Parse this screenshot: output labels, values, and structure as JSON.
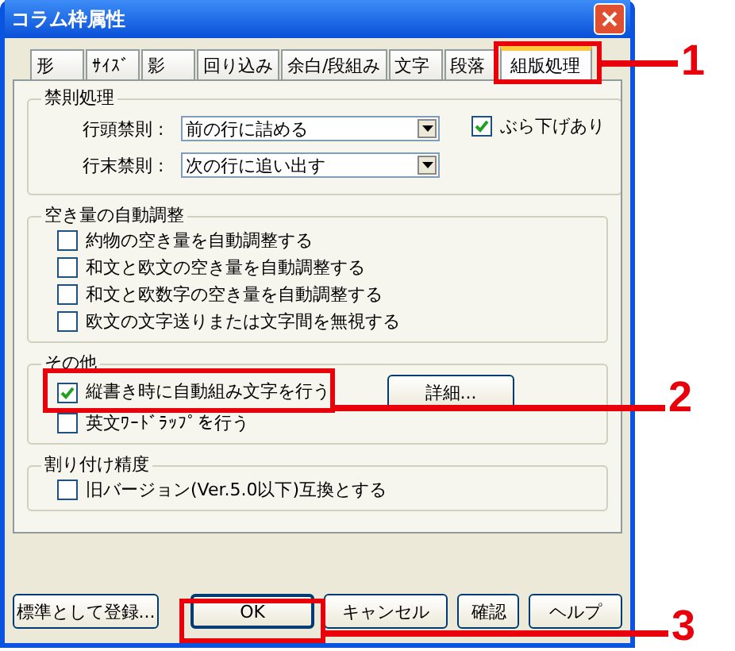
{
  "window": {
    "title": "コラム枠属性"
  },
  "tabs": [
    {
      "label": "形",
      "selected": false
    },
    {
      "label": "ｻｲｽﾞ",
      "selected": false
    },
    {
      "label": "影",
      "selected": false
    },
    {
      "label": "回り込み",
      "selected": false
    },
    {
      "label": "余白/段組み",
      "selected": false
    },
    {
      "label": "文字",
      "selected": false
    },
    {
      "label": "段落",
      "selected": false
    },
    {
      "label": "組版処理",
      "selected": true
    }
  ],
  "kinsoku": {
    "title": "禁則処理",
    "rows": [
      {
        "label": "行頭禁則 :",
        "value": "前の行に詰める"
      },
      {
        "label": "行末禁則 :",
        "value": "次の行に追い出す"
      }
    ],
    "hanging": {
      "label": "ぶら下げあり",
      "checked": true
    }
  },
  "spacing": {
    "title": "空き量の自動調整",
    "options": [
      {
        "label": "約物の空き量を自動調整する",
        "checked": false
      },
      {
        "label": "和文と欧文の空き量を自動調整する",
        "checked": false
      },
      {
        "label": "和文と欧数字の空き量を自動調整する",
        "checked": false
      },
      {
        "label": "欧文の文字送りまたは文字間を無視する",
        "checked": false
      }
    ]
  },
  "other": {
    "title": "その他",
    "options": [
      {
        "label": "縦書き時に自動組み文字を行う",
        "checked": true
      },
      {
        "label": "英文ﾜｰﾄﾞﾗｯﾌﾟを行う",
        "checked": false
      }
    ],
    "detail_button": "詳細..."
  },
  "precision": {
    "title": "割り付け精度",
    "options": [
      {
        "label": "旧バージョン(Ver.5.0以下)互換とする",
        "checked": false
      }
    ]
  },
  "buttons": [
    {
      "label": "標準として登録...",
      "default": false
    },
    {
      "label": "OK",
      "default": true
    },
    {
      "label": "キャンセル",
      "default": false
    },
    {
      "label": "確認",
      "default": false
    },
    {
      "label": "ヘルプ",
      "default": false
    }
  ],
  "callouts": [
    {
      "number": "1"
    },
    {
      "number": "2"
    },
    {
      "number": "3"
    }
  ]
}
